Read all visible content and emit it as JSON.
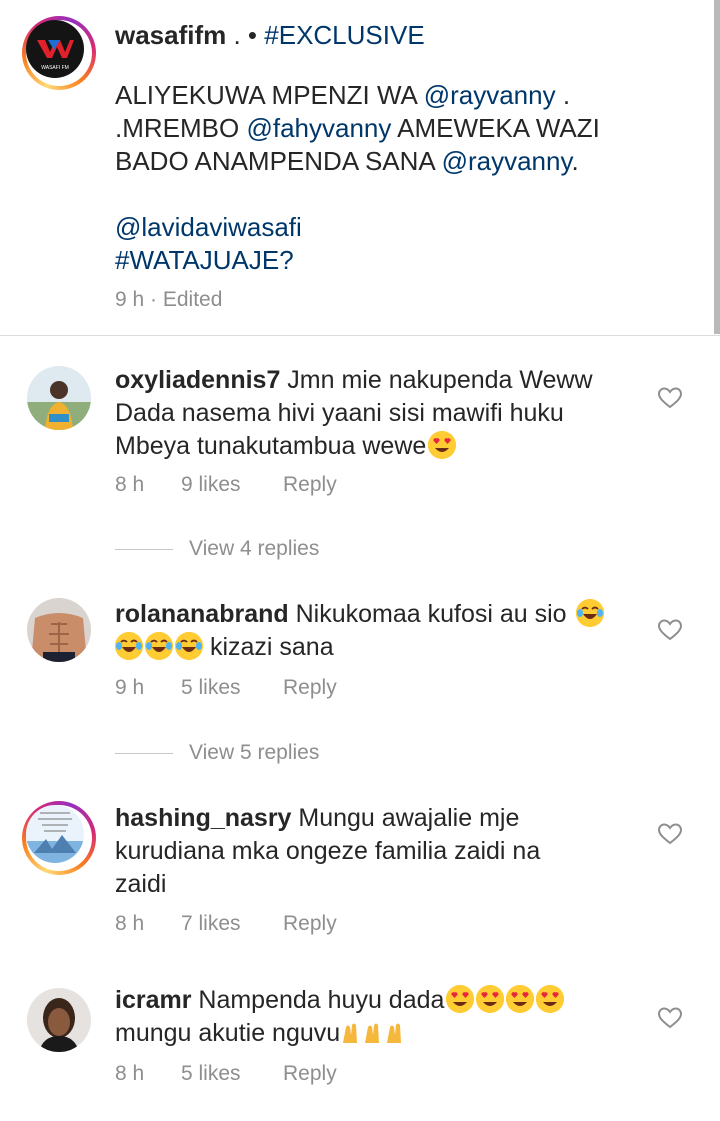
{
  "caption": {
    "username": "wasafifm",
    "sep": " . • ",
    "hashtag_exclusive": "#EXCLUSIVE",
    "line1_text": "ALIYEKUWA MPENZI WA ",
    "line1_mention": "@rayvanny",
    "line1_tail": " .",
    "line2_text": ".MREMBO ",
    "line2_mention": "@fahyvanny",
    "line2_tail": " AMEWEKA WAZI",
    "line3_text": "BADO ANAMPENDA SANA ",
    "line3_mention": "@rayvanny",
    "line3_tail": ".",
    "line4_mention": "@lavidaviwasafi",
    "line5_hashtag": "#WATAJUAJE?",
    "meta": "9 h · Edited",
    "avatar_label": "WASAFI FM"
  },
  "comments": [
    {
      "username": "oxyliadennis7",
      "lines": [
        " Jmn mie nakupenda Weww",
        "Dada nasema hivi yaani sisi mawifi huku",
        "Mbeya tunakutambua wewe"
      ],
      "time": "8 h",
      "likes": "9 likes",
      "reply": "Reply",
      "view_replies": "View 4 replies"
    },
    {
      "username": "rolananabrand",
      "lines": [
        " Nikukomaa kufosi au sio",
        " kizazi sana"
      ],
      "time": "9 h",
      "likes": "5 likes",
      "reply": "Reply",
      "view_replies": "View 5 replies"
    },
    {
      "username": "hashing_nasry",
      "lines": [
        " Mungu awajalie mje",
        "kurudiana mka ongeze familia zaidi na",
        "zaidi"
      ],
      "time": "8 h",
      "likes": "7 likes",
      "reply": "Reply"
    },
    {
      "username": "icramr",
      "lines": [
        " Nampenda huyu dada",
        "mungu akutie nguvu"
      ],
      "time": "8 h",
      "likes": "5 likes",
      "reply": "Reply"
    }
  ],
  "icons": {
    "heart": "heart-outline-icon",
    "heart_eyes": "heart-eyes-emoji",
    "joy": "tears-of-joy-emoji",
    "raised_hands": "raised-hands-emoji"
  },
  "colors": {
    "link": "#00376b",
    "meta": "#8e8e8e",
    "text": "#262626"
  }
}
